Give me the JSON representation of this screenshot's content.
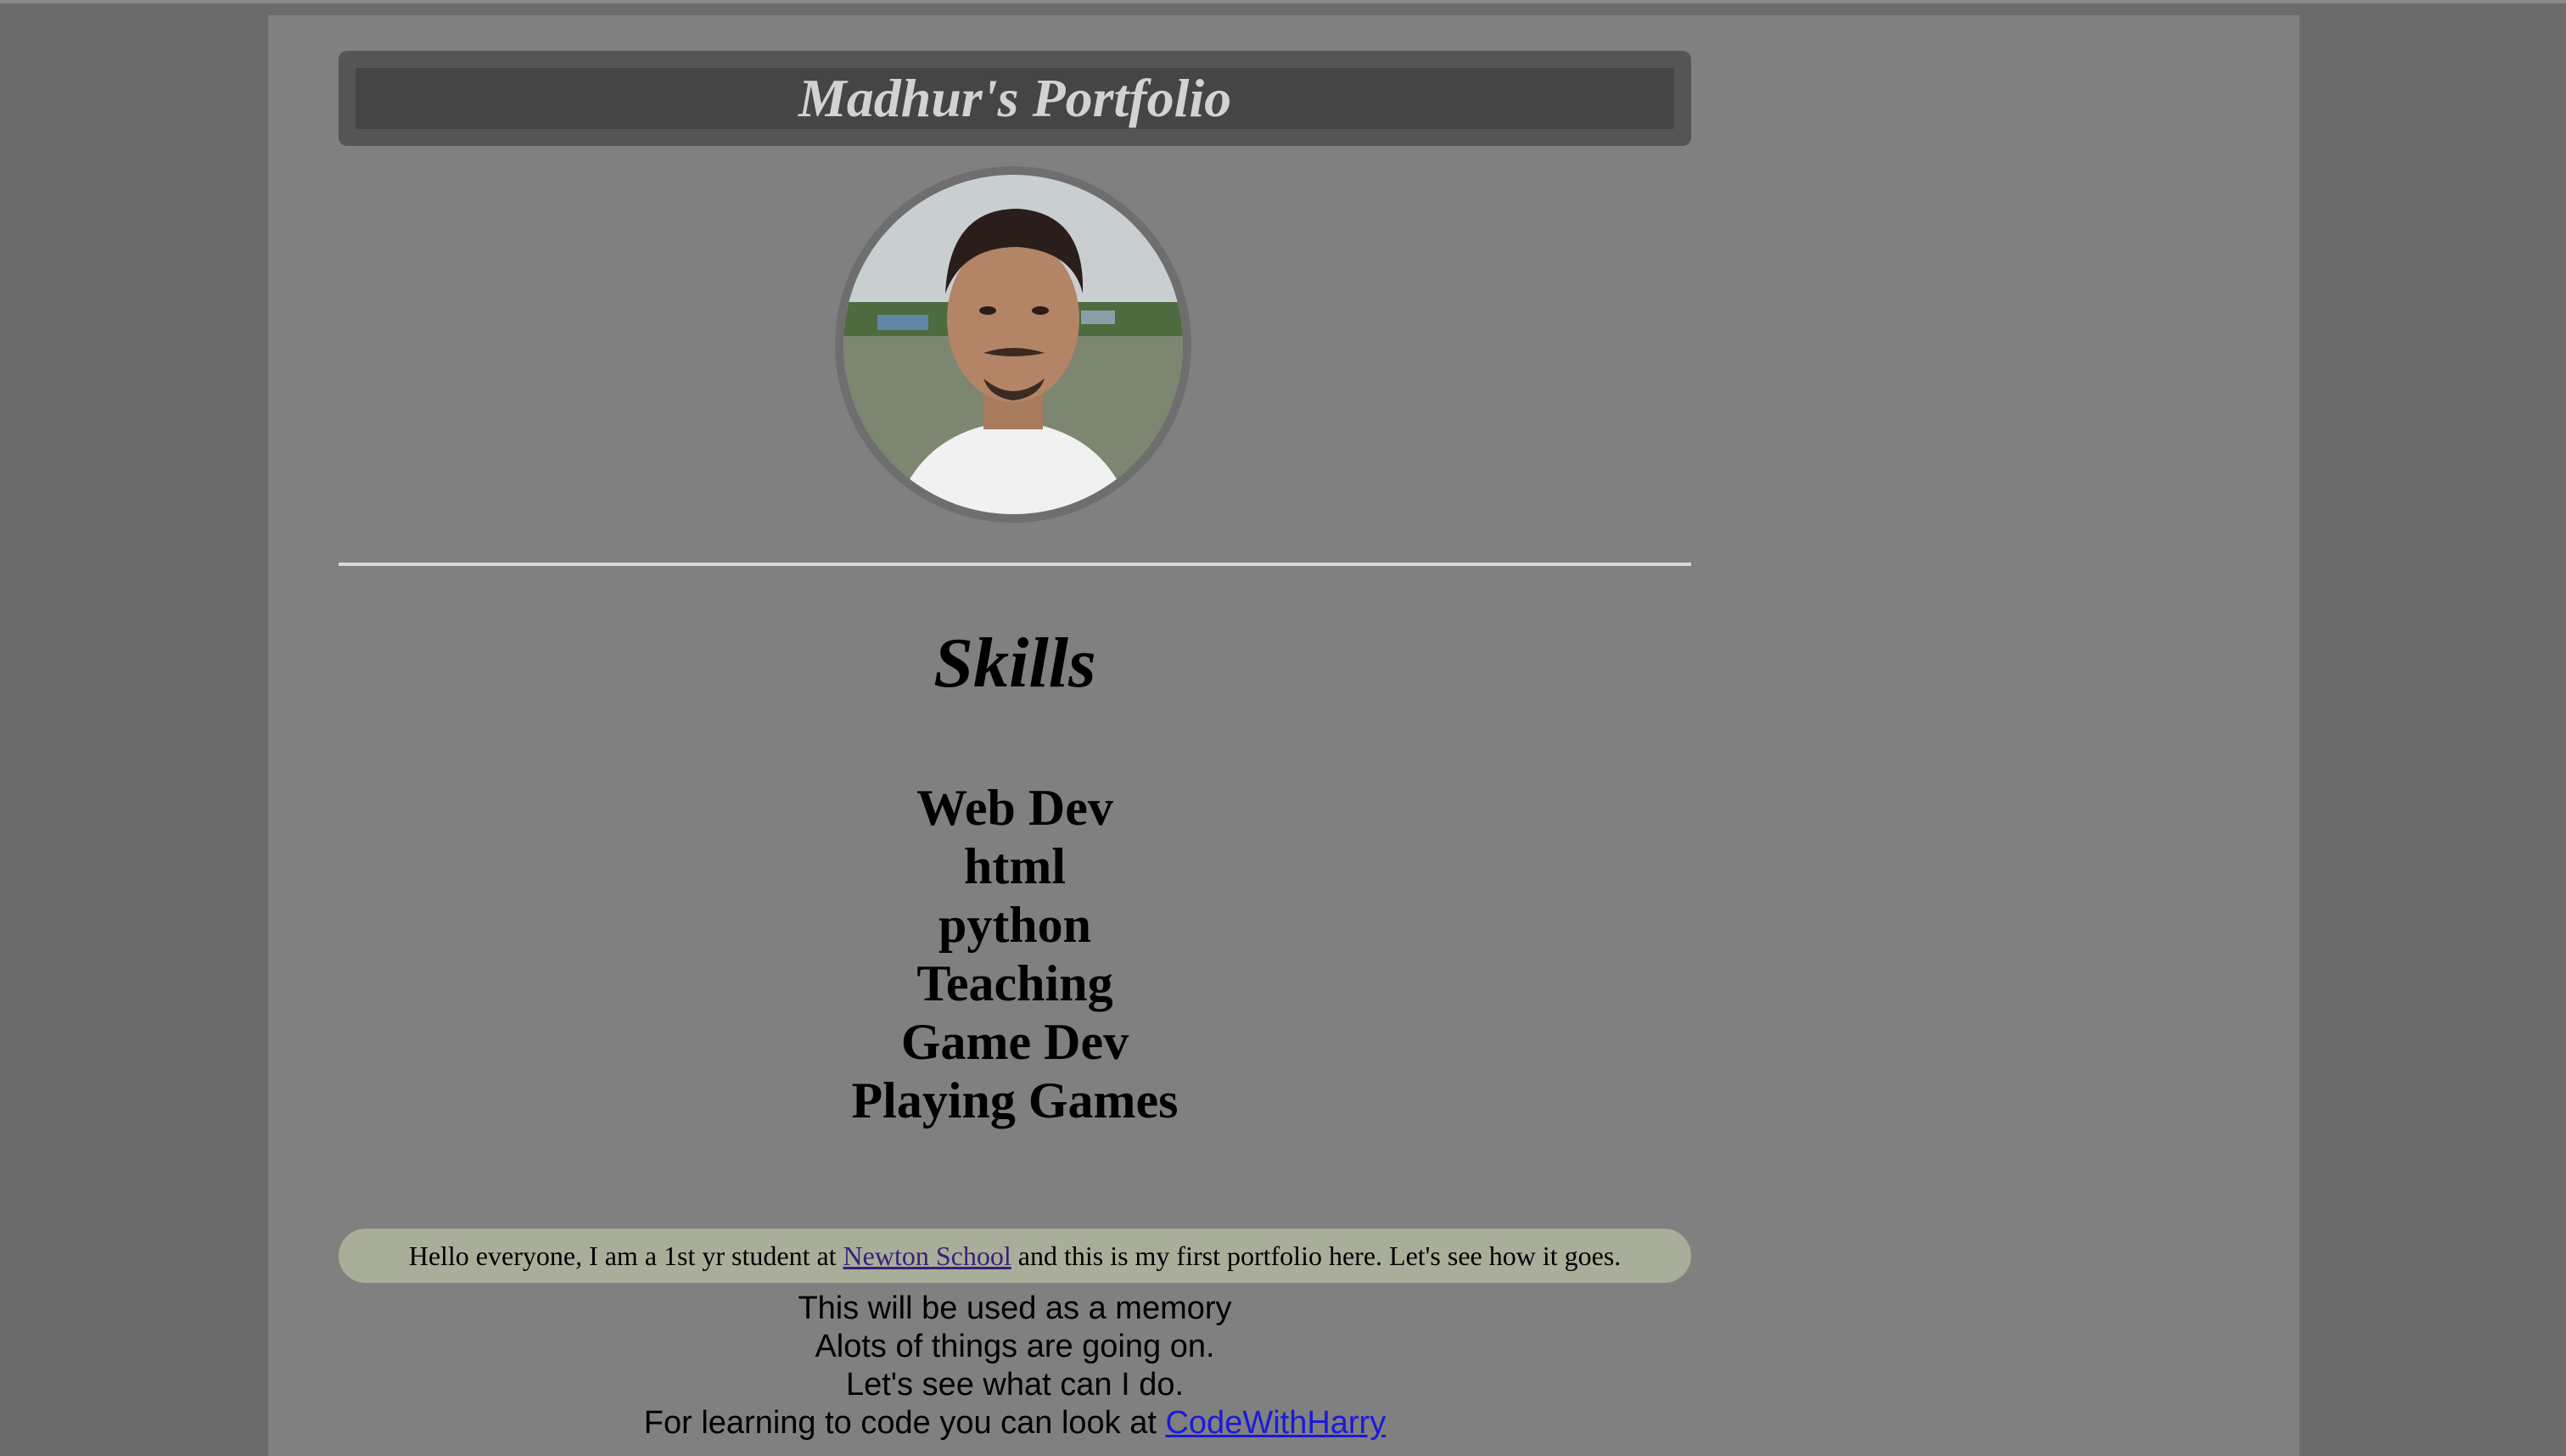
{
  "header": {
    "title": "Madhur's Portfolio"
  },
  "profile": {
    "avatar_alt": "profile photo"
  },
  "skills": {
    "title": "Skills",
    "items": [
      "Web Dev",
      "html",
      "python",
      "Teaching",
      "Game Dev",
      "Playing Games"
    ]
  },
  "intro": {
    "before": "Hello everyone, I am a 1st yr student at ",
    "link_text": "Newton School",
    "after": " and this is my first portfolio here. Let's see how it goes."
  },
  "notes": {
    "line1": "This will be used as a memory",
    "line2": "Alots of things are going on.",
    "line3": "Let's see what can I do.",
    "line4_before": "For learning to code you can look at ",
    "line4_link": "CodeWithHarry"
  },
  "colors": {
    "page_bg": "#808080",
    "outer_bg": "#6b6b6b",
    "header_bg": "#454545",
    "intro_bg": "#a9ae9a",
    "link_visited": "#3a1f7a",
    "link": "#1a1adb"
  }
}
